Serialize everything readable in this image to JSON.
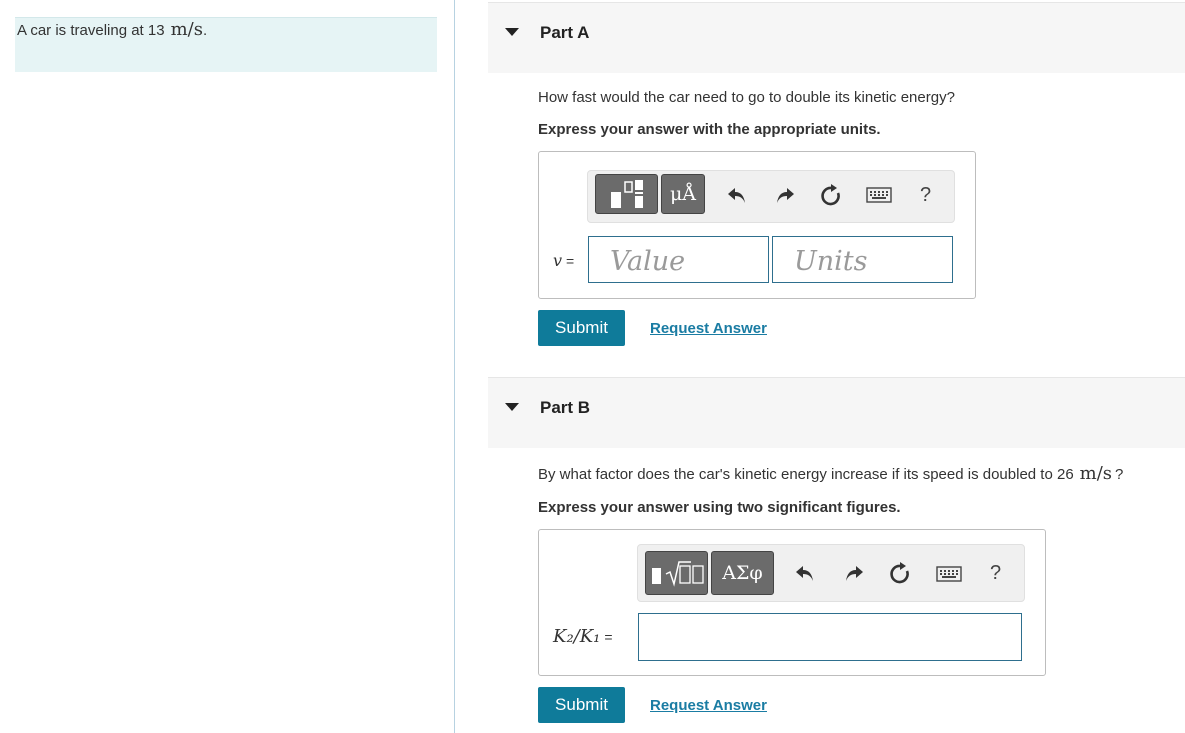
{
  "intro": {
    "text": "A car is traveling at 13",
    "unit": "m/s",
    "end": "."
  },
  "partA": {
    "title": "Part A",
    "question": "How fast would the car need to go to double its kinetic energy?",
    "instruction": "Express your answer with the appropriate units.",
    "toolbar": {
      "units_button": "μÅ",
      "help": "?"
    },
    "variable": "v",
    "equals": "=",
    "value_placeholder": "Value",
    "units_placeholder": "Units",
    "submit": "Submit",
    "request_answer": "Request Answer"
  },
  "partB": {
    "title": "Part B",
    "question": "By what factor does the car's kinetic energy increase if its speed is doubled to 26",
    "question_unit": "m/s",
    "question_end": "?",
    "instruction": "Express your answer using two significant figures.",
    "toolbar": {
      "greek_button": "ΑΣφ",
      "help": "?"
    },
    "variable": "K₂/K₁",
    "equals": "=",
    "submit": "Submit",
    "request_answer": "Request Answer"
  },
  "colors": {
    "accent": "#0f7b9a",
    "link": "#1a7ca3",
    "intro_bg": "#e6f4f5",
    "header_bg": "#f6f6f6"
  },
  "icons": [
    "templates-icon",
    "undo-icon",
    "redo-icon",
    "reset-icon",
    "keyboard-icon",
    "help-icon",
    "caret-down-icon"
  ]
}
